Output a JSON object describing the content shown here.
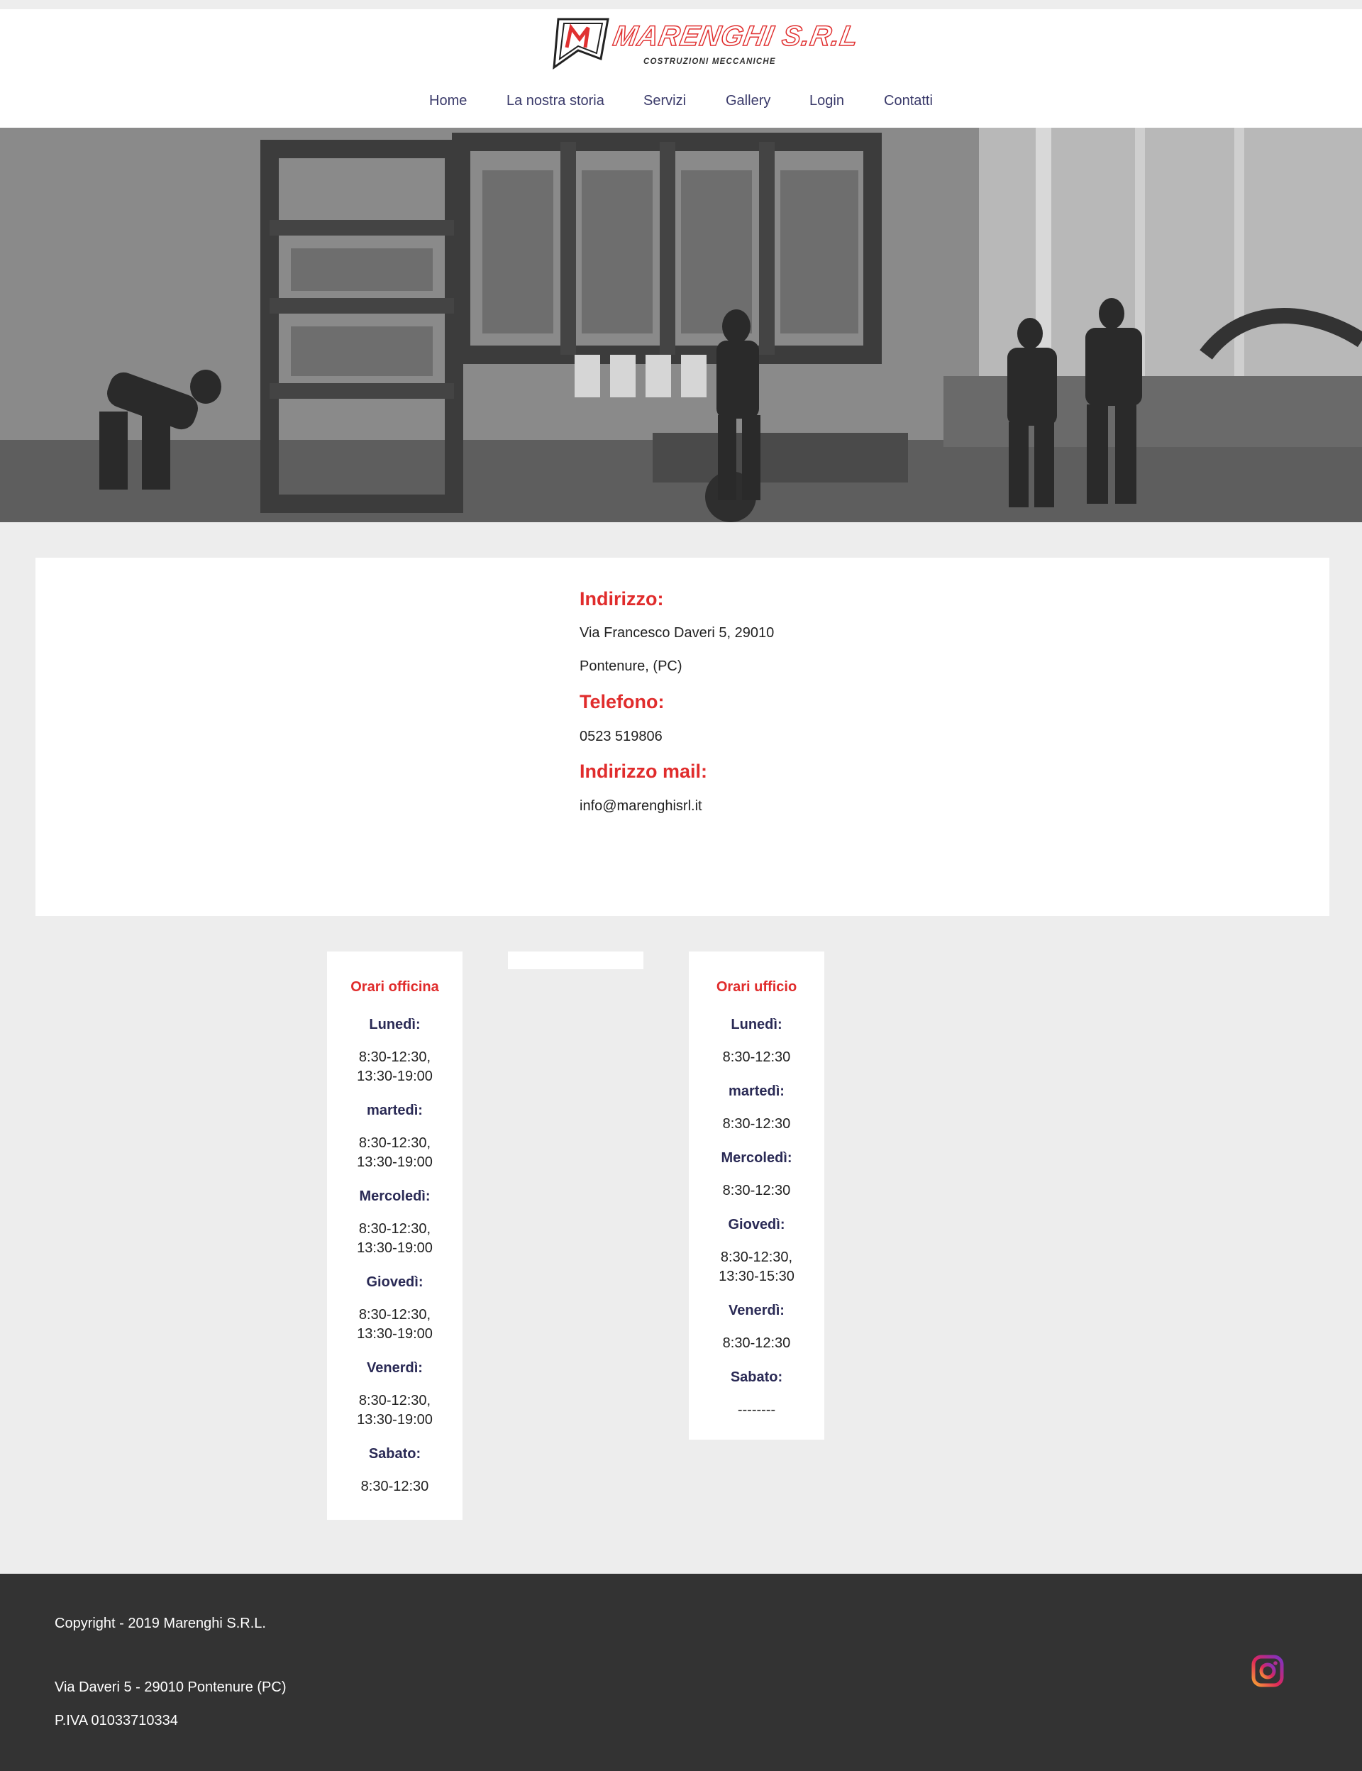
{
  "header": {
    "logo": {
      "name": "MARENGHI S.R.L",
      "tagline": "COSTRUZIONI MECCANICHE"
    },
    "nav": [
      {
        "label": "Home"
      },
      {
        "label": "La nostra storia"
      },
      {
        "label": "Servizi"
      },
      {
        "label": "Gallery"
      },
      {
        "label": "Login"
      },
      {
        "label": "Contatti"
      }
    ]
  },
  "hero": {
    "image": "black-and-white photo of workshop with workers and large steel frame structures"
  },
  "contact": {
    "address_heading": "Indirizzo:",
    "address_line1": "Via Francesco Daveri 5, 29010",
    "address_line2": "Pontenure, (PC)",
    "phone_heading": "Telefono:",
    "phone": "0523 519806",
    "email_heading": "Indirizzo mail:",
    "email": "info@marenghisrl.it"
  },
  "hours": {
    "workshop": {
      "title": "Orari officina",
      "days": [
        {
          "day": "Lunedì:",
          "time1": "8:30-12:30,",
          "time2": "13:30-19:00"
        },
        {
          "day": "martedì:",
          "time1": "8:30-12:30,",
          "time2": "13:30-19:00"
        },
        {
          "day": "Mercoledì:",
          "time1": "8:30-12:30,",
          "time2": "13:30-19:00"
        },
        {
          "day": "Giovedì:",
          "time1": "8:30-12:30,",
          "time2": "13:30-19:00"
        },
        {
          "day": "Venerdì:",
          "time1": "8:30-12:30,",
          "time2": "13:30-19:00"
        },
        {
          "day": "Sabato:",
          "time1": "8:30-12:30",
          "time2": ""
        }
      ]
    },
    "office": {
      "title": "Orari ufficio",
      "days": [
        {
          "day": "Lunedì:",
          "time1": "8:30-12:30",
          "time2": ""
        },
        {
          "day": "martedì:",
          "time1": "8:30-12:30",
          "time2": ""
        },
        {
          "day": "Mercoledì:",
          "time1": "8:30-12:30",
          "time2": ""
        },
        {
          "day": "Giovedì:",
          "time1": "8:30-12:30,",
          "time2": "13:30-15:30"
        },
        {
          "day": "Venerdì:",
          "time1": "8:30-12:30",
          "time2": ""
        },
        {
          "day": "Sabato:",
          "time1": "--------",
          "time2": ""
        }
      ]
    }
  },
  "footer": {
    "copyright": "Copyright - 2019 Marenghi S.R.L.",
    "address": "Via Daveri 5 - 29010 Pontenure (PC)",
    "vat": "P.IVA 01033710334",
    "social_icon": "instagram-icon"
  },
  "colors": {
    "accent_red": "#e02c2c",
    "nav_text": "#3a3a6a",
    "day_text": "#2a2a55",
    "footer_bg": "#333333",
    "page_bg": "#ededed"
  }
}
